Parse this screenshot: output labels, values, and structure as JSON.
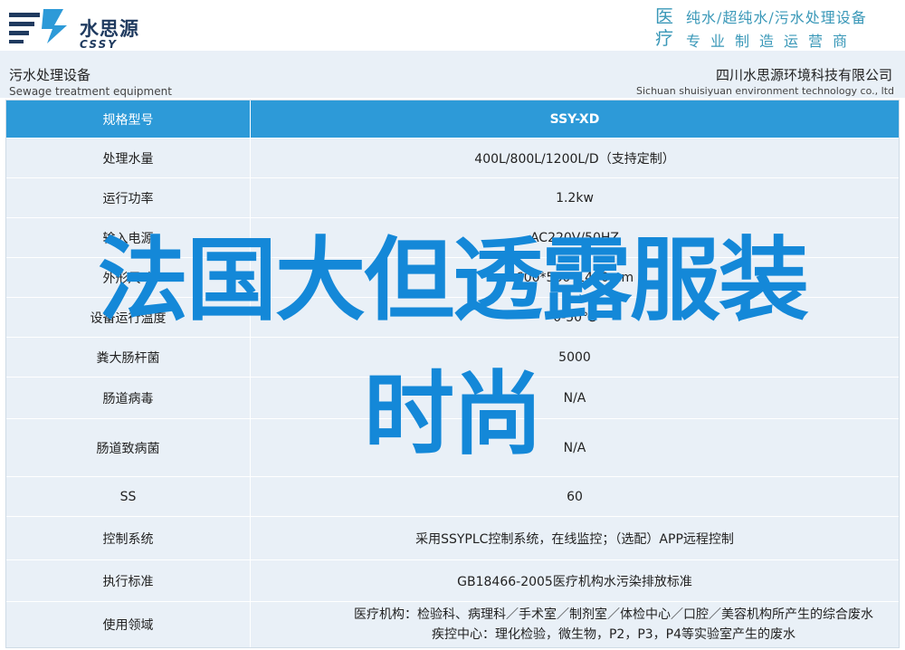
{
  "brand": {
    "name_cn": "水思源",
    "name_en": "CSSY",
    "accent": "#1f3a5f"
  },
  "slogan": {
    "big": "医疗",
    "line1": "纯水/超纯水/污水处理设备",
    "line2": "专业制造运营商",
    "color": "#3a98b8"
  },
  "header": {
    "left_cn": "污水处理设备",
    "left_en": "Sewage treatment equipment",
    "right_cn": "四川水思源环境科技有限公司",
    "right_en": "Sichuan shuisiyuan environment technology co., ltd"
  },
  "table": {
    "header_color": "#2d9ad8",
    "rows": [
      {
        "k": "规格型号",
        "v": "SSY-XD"
      },
      {
        "k": "处理水量",
        "v": "400L/800L/1200L/D（支持定制）"
      },
      {
        "k": "运行功率",
        "v": "1.2kw"
      },
      {
        "k": "输入电源",
        "v": "AC220V/50HZ"
      },
      {
        "k": "外形尺寸",
        "v": "600*560*1440mm"
      },
      {
        "k": "设备运行温度",
        "v": "0-50℃"
      },
      {
        "k": "粪大肠杆菌",
        "v": "5000"
      },
      {
        "k": "肠道病毒",
        "v": "N/A"
      },
      {
        "k": "肠道致病菌",
        "v": "N/A"
      },
      {
        "k": "SS",
        "v": "60"
      },
      {
        "k": "控制系统",
        "v": "采用SSYPLC控制系统，在线监控；（选配）APP远程控制"
      },
      {
        "k": "执行标准",
        "v": "GB18466-2005医疗机构水污染排放标准"
      },
      {
        "k": "使用领域",
        "v_line1": "医疗机构：检验科、病理科／手术室／制剂室／体检中心／口腔／美容机构所产生的综合废水",
        "v_line2": "疾控中心：理化检验，微生物，P2，P3，P4等实验室产生的废水"
      }
    ]
  },
  "overlay": {
    "line1": "法国大但透露服装",
    "line2": "时尚",
    "color": "#1488d8"
  }
}
